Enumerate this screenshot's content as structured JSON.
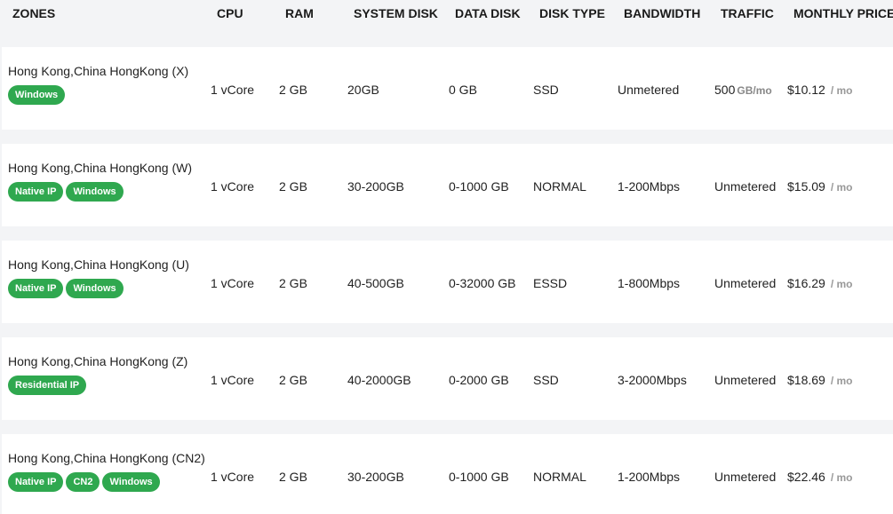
{
  "headers": {
    "zones": "ZONES",
    "cpu": "CPU",
    "ram": "RAM",
    "system_disk": "SYSTEM DISK",
    "data_disk": "DATA DISK",
    "disk_type": "DISK TYPE",
    "bandwidth": "BANDWIDTH",
    "traffic": "TRAFFIC",
    "monthly_price": "MONTHLY PRICE"
  },
  "colors": {
    "tag_green": "#2fa84f",
    "row_bg": "#ffffff",
    "page_bg": "#f3f4f6"
  },
  "rows": [
    {
      "zone": "Hong Kong,China HongKong (X)",
      "tags": [
        "Windows"
      ],
      "cpu": "1 vCore",
      "ram": "2 GB",
      "system_disk": "20GB",
      "data_disk": "0 GB",
      "disk_type": "SSD",
      "bandwidth": "Unmetered",
      "traffic": "500",
      "traffic_unit": "GB/mo",
      "price": "$10.12",
      "per": "/ mo"
    },
    {
      "zone": "Hong Kong,China HongKong (W)",
      "tags": [
        "Native IP",
        "Windows"
      ],
      "cpu": "1 vCore",
      "ram": "2 GB",
      "system_disk": "30-200GB",
      "data_disk": "0-1000 GB",
      "disk_type": "NORMAL",
      "bandwidth": "1-200Mbps",
      "traffic": "Unmetered",
      "traffic_unit": "",
      "price": "$15.09",
      "per": "/ mo"
    },
    {
      "zone": "Hong Kong,China HongKong (U)",
      "tags": [
        "Native IP",
        "Windows"
      ],
      "cpu": "1 vCore",
      "ram": "2 GB",
      "system_disk": "40-500GB",
      "data_disk": "0-32000 GB",
      "disk_type": "ESSD",
      "bandwidth": "1-800Mbps",
      "traffic": "Unmetered",
      "traffic_unit": "",
      "price": "$16.29",
      "per": "/ mo"
    },
    {
      "zone": "Hong Kong,China HongKong (Z)",
      "tags": [
        "Residential IP"
      ],
      "cpu": "1 vCore",
      "ram": "2 GB",
      "system_disk": "40-2000GB",
      "data_disk": "0-2000 GB",
      "disk_type": "SSD",
      "bandwidth": "3-2000Mbps",
      "traffic": "Unmetered",
      "traffic_unit": "",
      "price": "$18.69",
      "per": "/ mo"
    },
    {
      "zone": "Hong Kong,China HongKong (CN2)",
      "tags": [
        "Native IP",
        "CN2",
        "Windows"
      ],
      "cpu": "1 vCore",
      "ram": "2 GB",
      "system_disk": "30-200GB",
      "data_disk": "0-1000 GB",
      "disk_type": "NORMAL",
      "bandwidth": "1-200Mbps",
      "traffic": "Unmetered",
      "traffic_unit": "",
      "price": "$22.46",
      "per": "/ mo"
    }
  ]
}
